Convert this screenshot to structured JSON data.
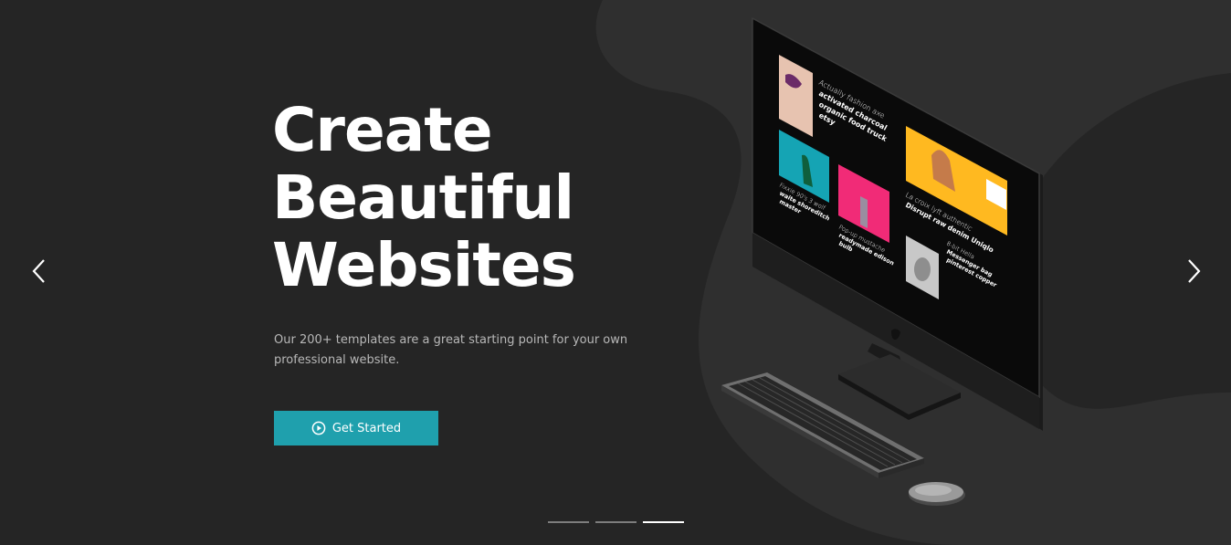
{
  "slider": {
    "headline": [
      "Create",
      "Beautiful",
      "Websites"
    ],
    "subtitle": "Our 200+ templates are a great starting point for your own professional website.",
    "cta_label": "Get Started",
    "prev_icon": "chevron-left-icon",
    "next_icon": "chevron-right-icon",
    "dots": [
      {
        "active": false
      },
      {
        "active": false
      },
      {
        "active": true
      }
    ]
  },
  "screen": {
    "card1": {
      "line1": "Actually fashion axe",
      "line2": "activated charcoal",
      "line3": "organic food truck",
      "line4": "etsy"
    },
    "card2": {
      "line1": "Fixxie 90's 3 wolf",
      "line2": "waite shoreditch",
      "line3": "master"
    },
    "card3": {
      "line1": "Pop-up mustache",
      "line2": "readymade edison",
      "line3": "bulb"
    },
    "card4": {
      "line1": "La croix lyft authentic",
      "line2": "Disrupt raw denim Uniqlo"
    },
    "card5": {
      "line1": "8-bit Hella",
      "line2": "Messenger bag",
      "line3": "pinterest copper"
    }
  },
  "colors": {
    "background": "#252525",
    "shape": "#2f2f2f",
    "accent": "#1fa0ad",
    "text": "#ffffff",
    "muted": "#b8b8b8"
  }
}
